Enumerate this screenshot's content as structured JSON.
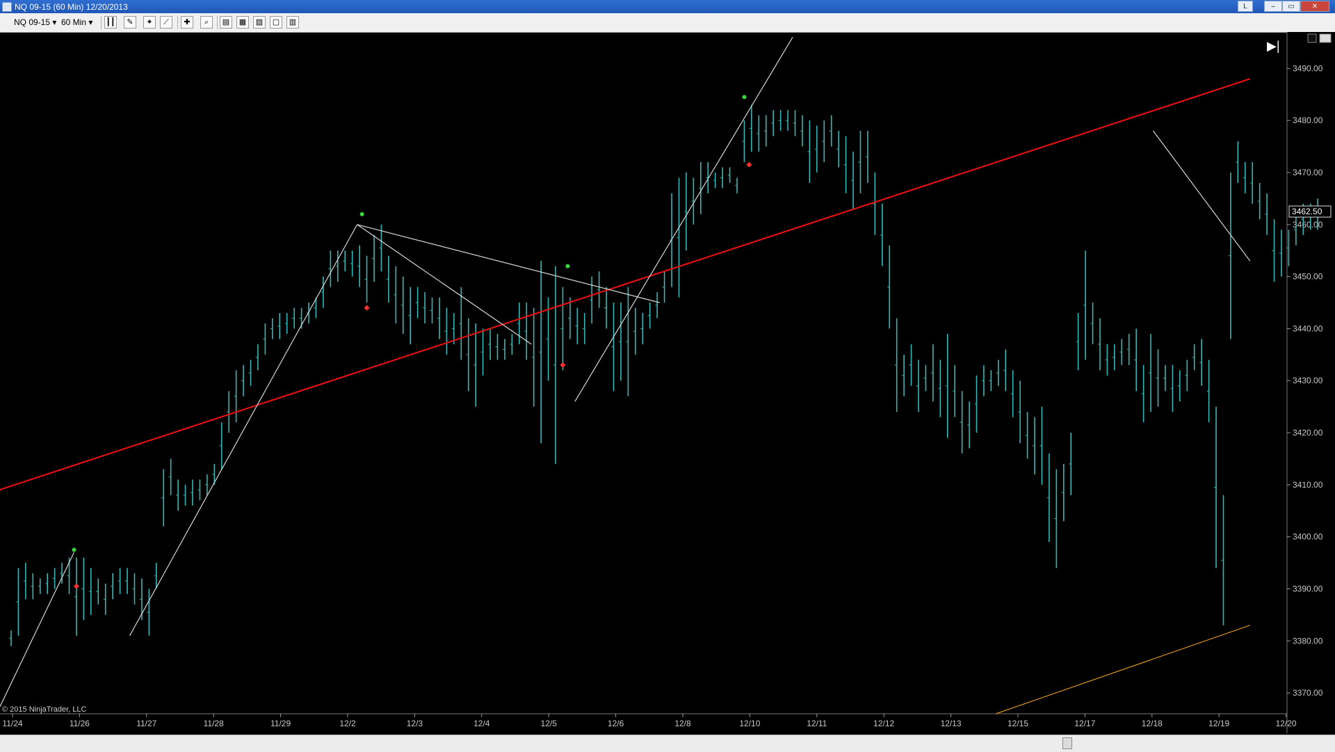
{
  "window": {
    "title": "NQ 09-15 (60 Min)  12/20/2013",
    "button_l": "L",
    "minimize": "–",
    "restore": "▭",
    "close": "✕"
  },
  "toolbar": {
    "instrument": "NQ 09-15",
    "interval": "60 Min"
  },
  "copyright": "© 2015 NinjaTrader, LLC",
  "current_price_label": "3462.50",
  "colors": {
    "background": "#000000",
    "bars": "#37b7b7",
    "trend_red": "#e01010",
    "trend_orange": "#d8941a",
    "lines_white": "#d8d8d8",
    "dot_green": "#3fd43f",
    "dot_red": "#ff3030"
  },
  "chart_data": {
    "type": "line",
    "y_axis_ticks": [
      "3490.00",
      "3480.00",
      "3470.00",
      "3460.00",
      "3450.00",
      "3440.00",
      "3430.00",
      "3420.00",
      "3410.00",
      "3400.00",
      "3390.00",
      "3380.00",
      "3370.00"
    ],
    "ylim": [
      3366,
      3497
    ],
    "x_axis_ticks": [
      "11/24",
      "11/26",
      "11/27",
      "11/28",
      "11/29",
      "12/2",
      "12/3",
      "12/4",
      "12/5",
      "12/6",
      "12/8",
      "12/10",
      "12/11",
      "12/12",
      "12/13",
      "12/15",
      "12/17",
      "12/18",
      "12/19",
      "12/20"
    ],
    "bars": [
      [
        0,
        3379,
        3382
      ],
      [
        0.3,
        3381,
        3394
      ],
      [
        0.6,
        3388,
        3395
      ],
      [
        0.9,
        3388,
        3393
      ],
      [
        1.2,
        3389,
        3392
      ],
      [
        1.5,
        3389,
        3393
      ],
      [
        1.8,
        3390,
        3394
      ],
      [
        2.1,
        3391,
        3395
      ],
      [
        2.4,
        3389,
        3396
      ],
      [
        2.7,
        3381,
        3396
      ],
      [
        3.0,
        3384,
        3396
      ],
      [
        3.3,
        3385,
        3394
      ],
      [
        3.6,
        3387,
        3392
      ],
      [
        3.9,
        3385,
        3391
      ],
      [
        4.2,
        3388,
        3393
      ],
      [
        4.5,
        3389,
        3394
      ],
      [
        4.8,
        3389,
        3394
      ],
      [
        5.1,
        3387,
        3393
      ],
      [
        5.4,
        3384,
        3392
      ],
      [
        5.7,
        3381,
        3390
      ],
      [
        6.0,
        3390,
        3395
      ],
      [
        6.3,
        3402,
        3413
      ],
      [
        6.6,
        3408,
        3415
      ],
      [
        6.9,
        3405,
        3411
      ],
      [
        7.2,
        3406,
        3410
      ],
      [
        7.5,
        3406,
        3411
      ],
      [
        7.8,
        3407,
        3411
      ],
      [
        8.1,
        3408,
        3412
      ],
      [
        8.4,
        3410,
        3414
      ],
      [
        8.7,
        3413,
        3422
      ],
      [
        9.0,
        3420,
        3428
      ],
      [
        9.3,
        3422,
        3432
      ],
      [
        9.6,
        3427,
        3433
      ],
      [
        9.9,
        3429,
        3434
      ],
      [
        10.2,
        3432,
        3437
      ],
      [
        10.5,
        3435,
        3441
      ],
      [
        10.8,
        3438,
        3442
      ],
      [
        11.1,
        3438,
        3443
      ],
      [
        11.4,
        3439,
        3443
      ],
      [
        11.7,
        3440,
        3444
      ],
      [
        12.0,
        3440,
        3444
      ],
      [
        12.3,
        3441,
        3445
      ],
      [
        12.6,
        3442,
        3446
      ],
      [
        12.9,
        3444,
        3450
      ],
      [
        13.2,
        3448,
        3455
      ],
      [
        13.5,
        3449,
        3455
      ],
      [
        13.8,
        3451,
        3455
      ],
      [
        14.1,
        3450,
        3455
      ],
      [
        14.4,
        3448,
        3456
      ],
      [
        14.7,
        3445,
        3454
      ],
      [
        15.0,
        3449,
        3458
      ],
      [
        15.3,
        3451,
        3460
      ],
      [
        15.6,
        3445,
        3454
      ],
      [
        15.9,
        3441,
        3452
      ],
      [
        16.2,
        3439,
        3450
      ],
      [
        16.5,
        3437,
        3448
      ],
      [
        16.8,
        3442,
        3448
      ],
      [
        17.1,
        3441,
        3447
      ],
      [
        17.4,
        3441,
        3446
      ],
      [
        17.7,
        3438,
        3446
      ],
      [
        18.0,
        3435,
        3444
      ],
      [
        18.3,
        3437,
        3443
      ],
      [
        18.6,
        3434,
        3448
      ],
      [
        18.9,
        3428,
        3442
      ],
      [
        19.2,
        3425,
        3441
      ],
      [
        19.5,
        3431,
        3440
      ],
      [
        19.8,
        3434,
        3440
      ],
      [
        20.1,
        3434,
        3439
      ],
      [
        20.4,
        3434,
        3438
      ],
      [
        20.7,
        3435,
        3439
      ],
      [
        21.0,
        3437,
        3445
      ],
      [
        21.3,
        3434,
        3445
      ],
      [
        21.6,
        3425,
        3444
      ],
      [
        21.9,
        3418,
        3453
      ],
      [
        22.2,
        3430,
        3446
      ],
      [
        22.5,
        3414,
        3452
      ],
      [
        22.8,
        3432,
        3448
      ],
      [
        23.1,
        3438,
        3446
      ],
      [
        23.4,
        3437,
        3444
      ],
      [
        23.7,
        3437,
        3443
      ],
      [
        24.0,
        3441,
        3450
      ],
      [
        24.3,
        3444,
        3451
      ],
      [
        24.6,
        3440,
        3448
      ],
      [
        24.9,
        3428,
        3445
      ],
      [
        25.2,
        3430,
        3445
      ],
      [
        25.5,
        3427,
        3448
      ],
      [
        25.8,
        3435,
        3444
      ],
      [
        26.1,
        3437,
        3443
      ],
      [
        26.4,
        3440,
        3445
      ],
      [
        26.7,
        3442,
        3447
      ],
      [
        27.0,
        3445,
        3451
      ],
      [
        27.3,
        3448,
        3466
      ],
      [
        27.6,
        3446,
        3469
      ],
      [
        27.9,
        3455,
        3470
      ],
      [
        28.2,
        3460,
        3469
      ],
      [
        28.5,
        3462,
        3472
      ],
      [
        28.8,
        3466,
        3472
      ],
      [
        29.1,
        3467,
        3470
      ],
      [
        29.4,
        3467,
        3471
      ],
      [
        29.7,
        3468,
        3471
      ],
      [
        30.0,
        3466,
        3469
      ],
      [
        30.3,
        3472,
        3480
      ],
      [
        30.6,
        3474,
        3483
      ],
      [
        30.9,
        3474,
        3481
      ],
      [
        31.2,
        3475,
        3481
      ],
      [
        31.5,
        3477,
        3482
      ],
      [
        31.8,
        3478,
        3482
      ],
      [
        32.1,
        3478,
        3482
      ],
      [
        32.4,
        3477,
        3482
      ],
      [
        32.7,
        3475,
        3481
      ],
      [
        33.0,
        3468,
        3480
      ],
      [
        33.3,
        3470,
        3479
      ],
      [
        33.6,
        3472,
        3480
      ],
      [
        33.9,
        3475,
        3481
      ],
      [
        34.2,
        3471,
        3478
      ],
      [
        34.5,
        3466,
        3477
      ],
      [
        34.8,
        3463,
        3474
      ],
      [
        35.1,
        3466,
        3478
      ],
      [
        35.4,
        3468,
        3478
      ],
      [
        35.7,
        3458,
        3470
      ],
      [
        36.0,
        3452,
        3464
      ],
      [
        36.3,
        3440,
        3456
      ],
      [
        36.6,
        3424,
        3442
      ],
      [
        36.9,
        3427,
        3435
      ],
      [
        37.2,
        3429,
        3437
      ],
      [
        37.5,
        3424,
        3434
      ],
      [
        37.8,
        3428,
        3433
      ],
      [
        38.1,
        3426,
        3437
      ],
      [
        38.4,
        3423,
        3434
      ],
      [
        38.7,
        3419,
        3439
      ],
      [
        39.0,
        3423,
        3433
      ],
      [
        39.3,
        3416,
        3428
      ],
      [
        39.6,
        3417,
        3426
      ],
      [
        39.9,
        3420,
        3431
      ],
      [
        40.2,
        3427,
        3433
      ],
      [
        40.5,
        3428,
        3432
      ],
      [
        40.8,
        3429,
        3434
      ],
      [
        41.1,
        3428,
        3436
      ],
      [
        41.4,
        3423,
        3432
      ],
      [
        41.7,
        3418,
        3430
      ],
      [
        42.0,
        3415,
        3424
      ],
      [
        42.3,
        3412,
        3423
      ],
      [
        42.6,
        3410,
        3425
      ],
      [
        42.9,
        3399,
        3416
      ],
      [
        43.2,
        3394,
        3413
      ],
      [
        43.5,
        3403,
        3414
      ],
      [
        43.8,
        3408,
        3420
      ],
      [
        44.1,
        3432,
        3443
      ],
      [
        44.4,
        3434,
        3455
      ],
      [
        44.7,
        3437,
        3445
      ],
      [
        45.0,
        3432,
        3442
      ],
      [
        45.3,
        3431,
        3437
      ],
      [
        45.6,
        3432,
        3437
      ],
      [
        45.9,
        3433,
        3438
      ],
      [
        46.2,
        3433,
        3439
      ],
      [
        46.5,
        3428,
        3440
      ],
      [
        46.8,
        3422,
        3433
      ],
      [
        47.1,
        3424,
        3439
      ],
      [
        47.4,
        3425,
        3436
      ],
      [
        47.7,
        3428,
        3433
      ],
      [
        48.0,
        3424,
        3433
      ],
      [
        48.3,
        3426,
        3432
      ],
      [
        48.6,
        3428,
        3434
      ],
      [
        48.9,
        3432,
        3437
      ],
      [
        49.2,
        3429,
        3438
      ],
      [
        49.5,
        3422,
        3434
      ],
      [
        49.8,
        3394,
        3425
      ],
      [
        50.1,
        3383,
        3408
      ],
      [
        50.4,
        3438,
        3470
      ],
      [
        50.7,
        3468,
        3476
      ],
      [
        51.0,
        3466,
        3472
      ],
      [
        51.3,
        3464,
        3472
      ],
      [
        51.6,
        3461,
        3468
      ],
      [
        51.9,
        3458,
        3466
      ],
      [
        52.2,
        3449,
        3461
      ],
      [
        52.5,
        3450,
        3459
      ],
      [
        52.8,
        3452,
        3459
      ],
      [
        53.1,
        3456,
        3462
      ],
      [
        53.4,
        3458,
        3464
      ],
      [
        53.7,
        3459,
        3464
      ],
      [
        54.0,
        3459,
        3465
      ]
    ],
    "trend_lines": [
      {
        "color": "red",
        "x1": -0.5,
        "y1": 3409,
        "x2": 51.2,
        "y2": 3488
      },
      {
        "color": "orange",
        "x1": 40.7,
        "y1": 3366,
        "x2": 51.2,
        "y2": 3383
      },
      {
        "color": "white",
        "x1": -0.5,
        "y1": 3367,
        "x2": 2.6,
        "y2": 3397
      },
      {
        "color": "white",
        "x1": 4.9,
        "y1": 3381,
        "x2": 14.3,
        "y2": 3460
      },
      {
        "color": "white",
        "x1": 14.3,
        "y1": 3460,
        "x2": 26.8,
        "y2": 3445
      },
      {
        "color": "white",
        "x1": 14.3,
        "y1": 3460,
        "x2": 21.5,
        "y2": 3437
      },
      {
        "color": "white",
        "x1": 23.3,
        "y1": 3426,
        "x2": 32.3,
        "y2": 3496
      },
      {
        "color": "white",
        "x1": 47.2,
        "y1": 3478,
        "x2": 51.2,
        "y2": 3453
      }
    ],
    "markers": [
      {
        "color": "green",
        "x": 2.6,
        "y": 3397.5
      },
      {
        "color": "red",
        "x": 2.7,
        "y": 3390.5
      },
      {
        "color": "green",
        "x": 14.5,
        "y": 3462
      },
      {
        "color": "red",
        "x": 14.7,
        "y": 3444
      },
      {
        "color": "green",
        "x": 23.0,
        "y": 3452
      },
      {
        "color": "red",
        "x": 22.8,
        "y": 3433
      },
      {
        "color": "green",
        "x": 30.3,
        "y": 3484.5
      },
      {
        "color": "red",
        "x": 30.5,
        "y": 3471.5
      }
    ]
  }
}
